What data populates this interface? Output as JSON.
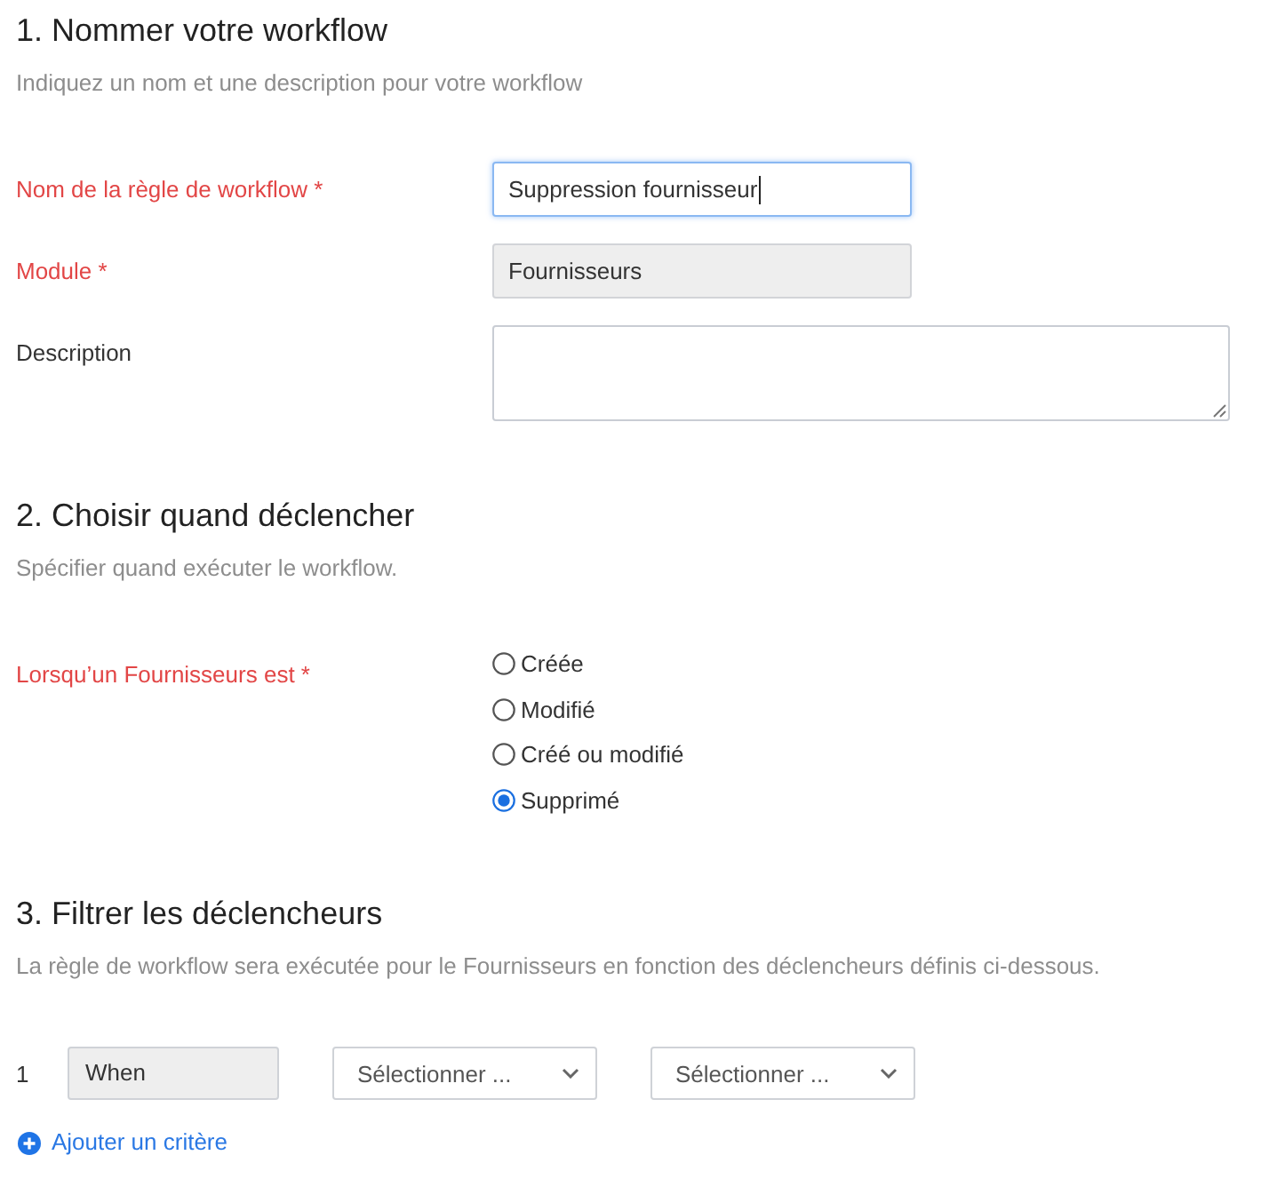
{
  "name_section": {
    "title": "1. Nommer votre workflow",
    "subtitle": "Indiquez un nom et une description pour votre workflow",
    "fields": [
      {
        "kind": "text",
        "label": "Nom de la règle de workflow *",
        "required": true,
        "value": "Suppression fournisseur",
        "focused": true,
        "disabled": false
      },
      {
        "kind": "text",
        "label": "Module *",
        "required": true,
        "value": "Fournisseurs",
        "focused": false,
        "disabled": true
      },
      {
        "kind": "textarea",
        "label": "Description",
        "required": false,
        "focused": false,
        "disabled": false
      }
    ]
  },
  "trigger_section": {
    "title": "2. Choisir quand déclencher",
    "subtitle": "Spécifier quand exécuter le workflow.",
    "label": "Lorsqu’un Fournisseurs est *",
    "required": true,
    "options": [
      {
        "label": "Créée",
        "selected": false
      },
      {
        "label": "Modifié",
        "selected": false
      },
      {
        "label": "Créé ou modifié",
        "selected": false
      },
      {
        "label": "Supprimé",
        "selected": true
      }
    ]
  },
  "filter_section": {
    "title": "3. Filtrer les déclencheurs",
    "subtitle": "La règle de workflow sera exécutée pour le Fournisseurs en fonction des déclencheurs définis ci-dessous.",
    "criteria": [
      {
        "number": "1",
        "field": {
          "value": "When",
          "disabled": true
        },
        "selects": [
          {
            "placeholder": "Sélectionner ..."
          },
          {
            "placeholder": "Sélectionner ..."
          }
        ]
      }
    ],
    "add_link": "Ajouter un critère"
  }
}
